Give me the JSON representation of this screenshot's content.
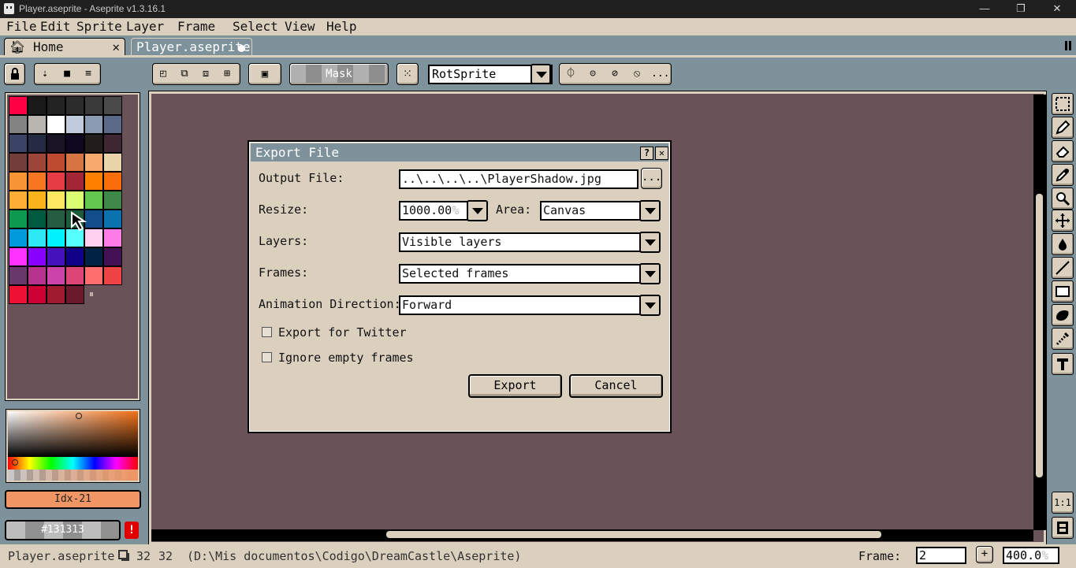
{
  "window": {
    "title": "Player.aseprite - Aseprite v1.3.16.1",
    "minimize": "—",
    "maximize": "❐",
    "close": "✕"
  },
  "menu": [
    "File",
    "Edit",
    "Sprite",
    "Layer",
    "Frame",
    "Select",
    "View",
    "Help"
  ],
  "tabs": {
    "home_label": "Home",
    "home_close": "✕",
    "doc_label": "Player.aseprite"
  },
  "toolbar": {
    "mask_label": "Mask",
    "rotation_algorithm": "RotSprite",
    "more_label": "..."
  },
  "palette": {
    "colors": [
      [
        "#ff0044",
        "#1a1a1a",
        "#232323",
        "#2c2c2c",
        "#3a3a3a",
        "#4a4a4a"
      ],
      [
        "#838383",
        "#b8b5b0",
        "#ffffff",
        "#c0cbdc",
        "#8b9bb4",
        "#5a6988"
      ],
      [
        "#3a4466",
        "#262b44",
        "#181425",
        "#100820",
        "#221c1a",
        "#3e2731"
      ],
      [
        "#733e39",
        "#9e4539",
        "#be4a2f",
        "#d77643",
        "#f7a96e",
        "#ead4aa"
      ],
      [
        "#f79433",
        "#f77622",
        "#e43b44",
        "#a22633",
        "#ff7f00",
        "#fa6e0a"
      ],
      [
        "#feae34",
        "#fbb31a",
        "#fee761",
        "#dbfd72",
        "#63c74d",
        "#3e8948"
      ],
      [
        "#0e9a4e",
        "#005a3e",
        "#265c42",
        "#1d5c3a",
        "#124e89",
        "#0b72b0"
      ],
      [
        "#0099db",
        "#2ce8f5",
        "#00f2ff",
        "#55ffff",
        "#ffd0f0",
        "#ff7ce8"
      ],
      [
        "#ff33ff",
        "#8800ff",
        "#4411bb",
        "#110088",
        "#002244",
        "#441155"
      ],
      [
        "#68386c",
        "#b5338a",
        "#cc44aa",
        "#dd4477",
        "#ff6e6e",
        "#ee4444"
      ],
      [
        "#ee1133",
        "#cc0033",
        "#a01a30",
        "#6a1a2a",
        "",
        ""
      ]
    ]
  },
  "color_bar": {
    "index_label": "Idx-21",
    "hex_label": "#131313",
    "warning": "!"
  },
  "dialog": {
    "title": "Export File",
    "help": "?",
    "close": "✕",
    "output_label": "Output File:",
    "output_value": "..\\..\\..\\..\\PlayerShadow.jpg",
    "browse_label": "...",
    "resize_label": "Resize:",
    "resize_value": "1000.00",
    "resize_unit": "%",
    "area_label": "Area:",
    "area_value": "Canvas",
    "layers_label": "Layers:",
    "layers_value": "Visible layers",
    "frames_label": "Frames:",
    "frames_value": "Selected frames",
    "direction_label": "Animation Direction:",
    "direction_value": "Forward",
    "twitter_label": "Export for Twitter",
    "twitter_checked": false,
    "ignore_label": "Ignore empty frames",
    "ignore_checked": false,
    "export_label": "Export",
    "cancel_label": "Cancel"
  },
  "status": {
    "filename": "Player.aseprite",
    "size_w": "32",
    "size_h": "32",
    "path": "(D:\\Mis documentos\\Codigo\\DreamCastle\\Aseprite)",
    "frame_label": "Frame:",
    "frame_value": "2",
    "add_frame": "+",
    "zoom_value": "400.0",
    "zoom_unit": "%"
  },
  "right_tools_bottom": [
    "1:1",
    "⏶"
  ]
}
